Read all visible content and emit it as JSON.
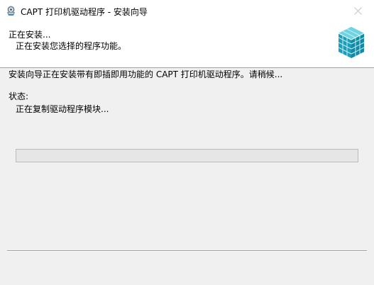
{
  "window": {
    "title": "CAPT 打印机驱动程序 - 安装向导"
  },
  "header": {
    "title": "正在安装...",
    "subtitle": "正在安装您选择的程序功能。"
  },
  "main": {
    "description": "安装向导正在安装带有即插即用功能的 CAPT 打印机驱动程序。请稍候...",
    "status_label": "状态:",
    "status_value": "正在复制驱动程序模块..."
  },
  "progress": {
    "fraction": 0
  },
  "icons": {
    "app": "printer-setup-icon",
    "header": "package-install-icon",
    "close": "close-icon"
  },
  "colors": {
    "titlebar": "#ffffff",
    "background": "#f0f0f0",
    "progress_fill": "#06b025",
    "header_graphic": "#2bb0c8"
  }
}
